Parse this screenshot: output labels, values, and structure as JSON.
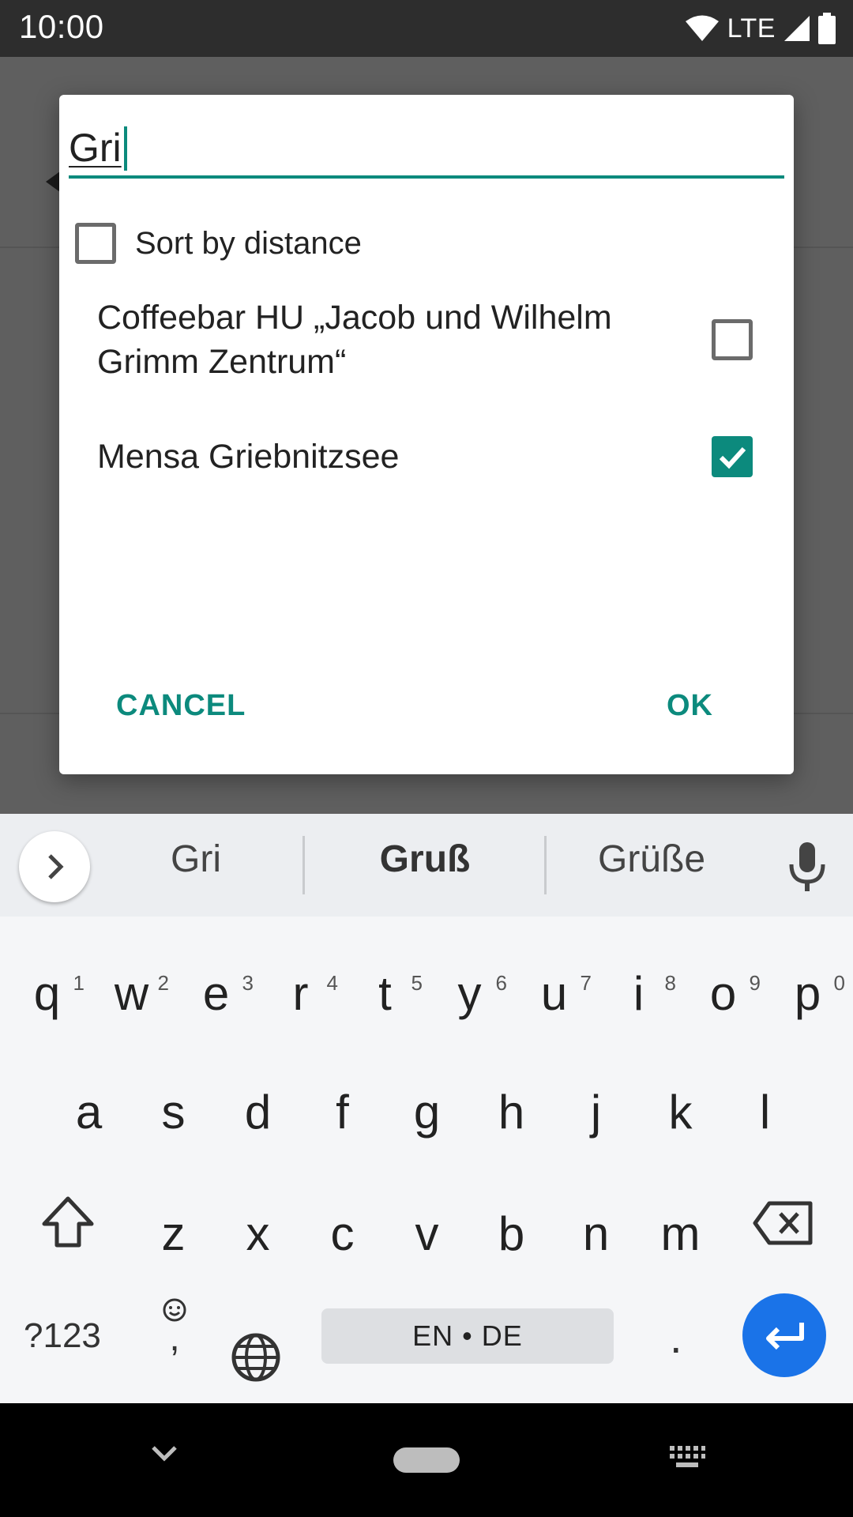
{
  "status_bar": {
    "time": "10:00",
    "network": "LTE",
    "icons": [
      "wifi-icon",
      "signal-icon",
      "battery-icon"
    ]
  },
  "dialog": {
    "search_value": "Gri",
    "sort_by_distance": {
      "label": "Sort by distance",
      "checked": false
    },
    "items": [
      {
        "label": "Coffeebar HU „Jacob und Wilhelm Grimm Zentrum“",
        "checked": false
      },
      {
        "label": "Mensa Griebnitzsee",
        "checked": true
      }
    ],
    "cancel_label": "CANCEL",
    "ok_label": "OK"
  },
  "keyboard": {
    "suggestions": [
      "Gri",
      "Gruß",
      "Grüße"
    ],
    "row1": [
      {
        "key": "q",
        "num": "1"
      },
      {
        "key": "w",
        "num": "2"
      },
      {
        "key": "e",
        "num": "3"
      },
      {
        "key": "r",
        "num": "4"
      },
      {
        "key": "t",
        "num": "5"
      },
      {
        "key": "y",
        "num": "6"
      },
      {
        "key": "u",
        "num": "7"
      },
      {
        "key": "i",
        "num": "8"
      },
      {
        "key": "o",
        "num": "9"
      },
      {
        "key": "p",
        "num": "0"
      }
    ],
    "row2": [
      "a",
      "s",
      "d",
      "f",
      "g",
      "h",
      "j",
      "k",
      "l"
    ],
    "row3": [
      "z",
      "x",
      "c",
      "v",
      "b",
      "n",
      "m"
    ],
    "symbols_label": "?123",
    "comma": ",",
    "space_label": "EN • DE",
    "period": "."
  },
  "colors": {
    "accent": "#0c8a7d",
    "enter": "#1a73e8"
  }
}
